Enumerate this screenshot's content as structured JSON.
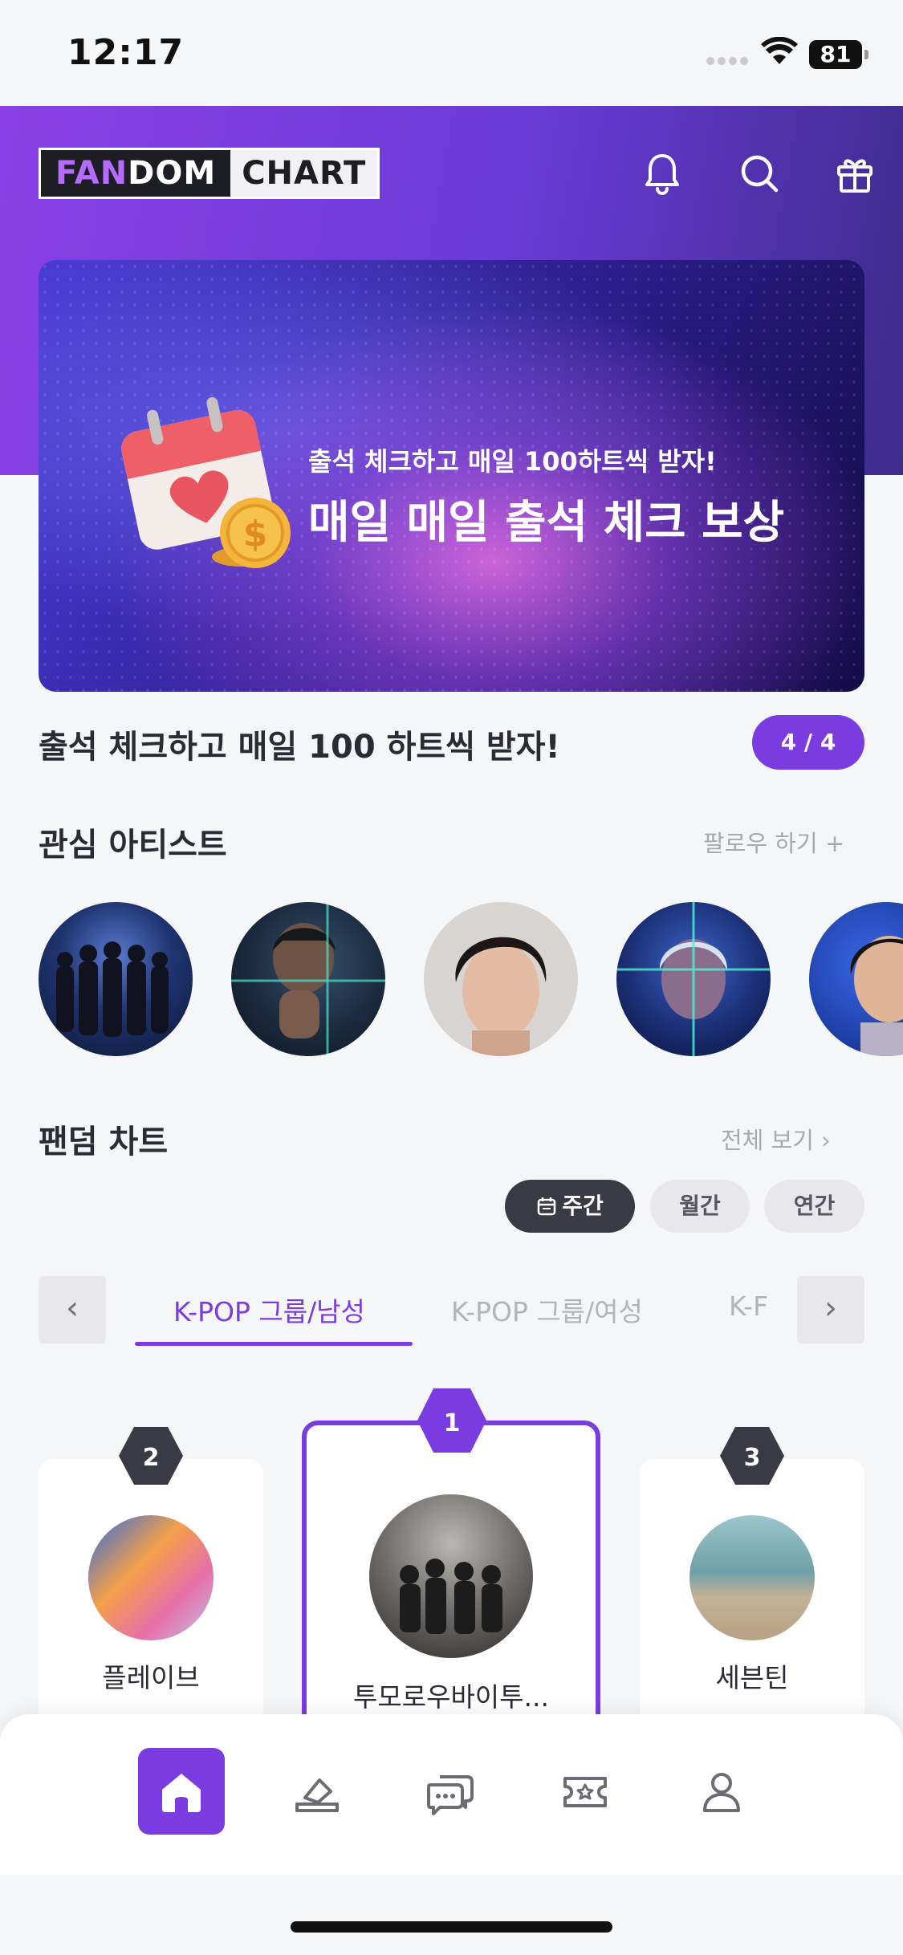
{
  "status_bar": {
    "time": "12:17",
    "battery": "81"
  },
  "header": {
    "logo_part1_accent": "FAN",
    "logo_part1_rest": "DOM",
    "logo_part2": "CHART",
    "icons": [
      "bell-icon",
      "search-icon",
      "gift-icon"
    ]
  },
  "banner": {
    "subtitle": "출석 체크하고 매일 100하트씩 받자!",
    "title": "매일 매일 출석 체크 보상",
    "caption": "출석 체크하고 매일 100 하트씩 받자!",
    "pager": "4 / 4"
  },
  "interest_artists": {
    "title": "관심 아티스트",
    "follow_link": "팔로우 하기 +"
  },
  "fandom_chart": {
    "title": "팬덤 차트",
    "view_all": "전체 보기 ›",
    "periods": {
      "weekly": "주간",
      "monthly": "월간",
      "yearly": "연간"
    },
    "categories": [
      "K-POP 그룹/남성",
      "K-POP 그룹/여성",
      "K-F"
    ],
    "prev_arrow": "‹",
    "next_arrow": "›",
    "rankings": [
      {
        "rank": "2",
        "name": "플레이브"
      },
      {
        "rank": "1",
        "name": "투모로우바이투..."
      },
      {
        "rank": "3",
        "name": "세븐틴"
      }
    ]
  },
  "colors": {
    "accent": "#7a3ce0",
    "dark": "#3a3a45",
    "background": "#f5f6f8"
  }
}
